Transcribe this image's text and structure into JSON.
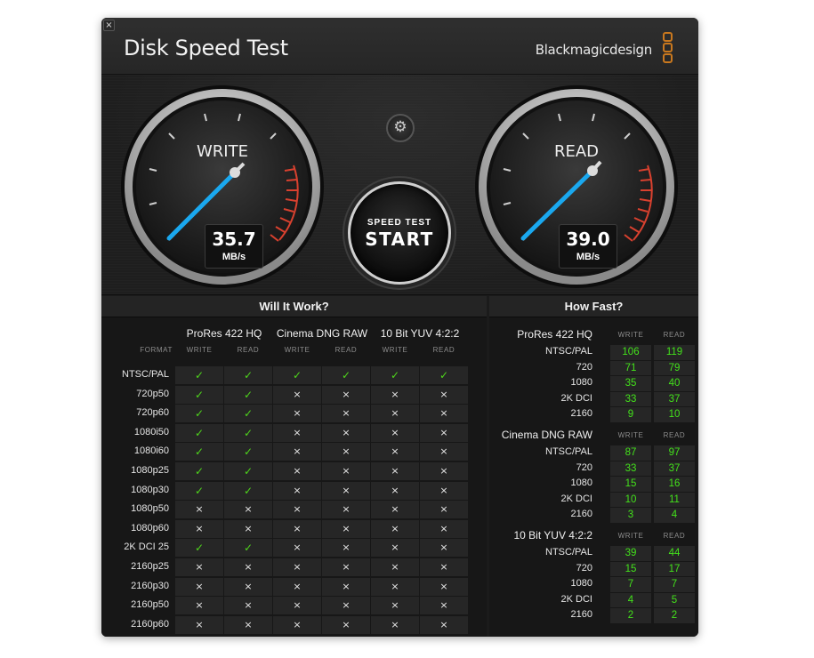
{
  "window": {
    "title": "Disk Speed Test",
    "brand": "Blackmagicdesign",
    "close_glyph": "×"
  },
  "colors": {
    "needle": "#1aa8ef",
    "check": "#4fd61c",
    "value": "#43e21b",
    "redline": "#d9412f",
    "brand_logo": "#c9781e"
  },
  "gauges": {
    "write": {
      "label": "WRITE",
      "value": "35.7",
      "unit": "MB/s"
    },
    "read": {
      "label": "READ",
      "value": "39.0",
      "unit": "MB/s"
    }
  },
  "controls": {
    "settings_icon": "gear-icon",
    "settings_glyph": "⚙",
    "start_small": "SPEED TEST",
    "start_big": "START"
  },
  "will_it_work": {
    "heading": "Will It Work?",
    "format_label": "FORMAT",
    "write_label": "WRITE",
    "read_label": "READ",
    "groups": [
      "ProRes 422 HQ",
      "Cinema DNG RAW",
      "10 Bit YUV 4:2:2"
    ],
    "check_glyph": "✓",
    "cross_glyph": "×",
    "rows": [
      {
        "format": "NTSC/PAL",
        "cells": [
          true,
          true,
          true,
          true,
          true,
          true
        ]
      },
      {
        "format": "720p50",
        "cells": [
          true,
          true,
          false,
          false,
          false,
          false
        ]
      },
      {
        "format": "720p60",
        "cells": [
          true,
          true,
          false,
          false,
          false,
          false
        ]
      },
      {
        "format": "1080i50",
        "cells": [
          true,
          true,
          false,
          false,
          false,
          false
        ]
      },
      {
        "format": "1080i60",
        "cells": [
          true,
          true,
          false,
          false,
          false,
          false
        ]
      },
      {
        "format": "1080p25",
        "cells": [
          true,
          true,
          false,
          false,
          false,
          false
        ]
      },
      {
        "format": "1080p30",
        "cells": [
          true,
          true,
          false,
          false,
          false,
          false
        ]
      },
      {
        "format": "1080p50",
        "cells": [
          false,
          false,
          false,
          false,
          false,
          false
        ]
      },
      {
        "format": "1080p60",
        "cells": [
          false,
          false,
          false,
          false,
          false,
          false
        ]
      },
      {
        "format": "2K DCI 25",
        "cells": [
          true,
          true,
          false,
          false,
          false,
          false
        ]
      },
      {
        "format": "2160p25",
        "cells": [
          false,
          false,
          false,
          false,
          false,
          false
        ]
      },
      {
        "format": "2160p30",
        "cells": [
          false,
          false,
          false,
          false,
          false,
          false
        ]
      },
      {
        "format": "2160p50",
        "cells": [
          false,
          false,
          false,
          false,
          false,
          false
        ]
      },
      {
        "format": "2160p60",
        "cells": [
          false,
          false,
          false,
          false,
          false,
          false
        ]
      }
    ]
  },
  "how_fast": {
    "heading": "How Fast?",
    "write_label": "WRITE",
    "read_label": "READ",
    "groups": [
      {
        "title": "ProRes 422 HQ",
        "rows": [
          {
            "format": "NTSC/PAL",
            "write": "106",
            "read": "119"
          },
          {
            "format": "720",
            "write": "71",
            "read": "79"
          },
          {
            "format": "1080",
            "write": "35",
            "read": "40"
          },
          {
            "format": "2K DCI",
            "write": "33",
            "read": "37"
          },
          {
            "format": "2160",
            "write": "9",
            "read": "10"
          }
        ]
      },
      {
        "title": "Cinema DNG RAW",
        "rows": [
          {
            "format": "NTSC/PAL",
            "write": "87",
            "read": "97"
          },
          {
            "format": "720",
            "write": "33",
            "read": "37"
          },
          {
            "format": "1080",
            "write": "15",
            "read": "16"
          },
          {
            "format": "2K DCI",
            "write": "10",
            "read": "11"
          },
          {
            "format": "2160",
            "write": "3",
            "read": "4"
          }
        ]
      },
      {
        "title": "10 Bit YUV 4:2:2",
        "rows": [
          {
            "format": "NTSC/PAL",
            "write": "39",
            "read": "44"
          },
          {
            "format": "720",
            "write": "15",
            "read": "17"
          },
          {
            "format": "1080",
            "write": "7",
            "read": "7"
          },
          {
            "format": "2K DCI",
            "write": "4",
            "read": "5"
          },
          {
            "format": "2160",
            "write": "2",
            "read": "2"
          }
        ]
      }
    ]
  }
}
